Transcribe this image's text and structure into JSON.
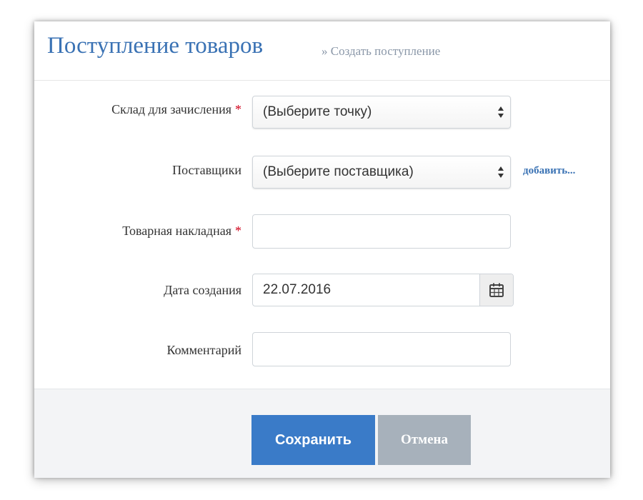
{
  "header": {
    "title": "Поступление товаров",
    "breadcrumb": "» Создать поступление"
  },
  "form": {
    "warehouse": {
      "label": "Склад для зачисления",
      "required_mark": "*",
      "value": "(Выберите точку)"
    },
    "supplier": {
      "label": "Поставщики",
      "value": "(Выберите поставщика)",
      "add_link": "добавить..."
    },
    "invoice": {
      "label": "Товарная накладная",
      "required_mark": "*",
      "value": ""
    },
    "date": {
      "label": "Дата создания",
      "value": "22.07.2016",
      "icon": "calendar-icon"
    },
    "comment": {
      "label": "Комментарий",
      "value": ""
    }
  },
  "footer": {
    "save_label": "Сохранить",
    "cancel_label": "Отмена"
  },
  "colors": {
    "accent": "#3a72b4",
    "primary_button": "#3a7bc8",
    "secondary_button": "#a7b1bb",
    "required": "#d0021b"
  }
}
